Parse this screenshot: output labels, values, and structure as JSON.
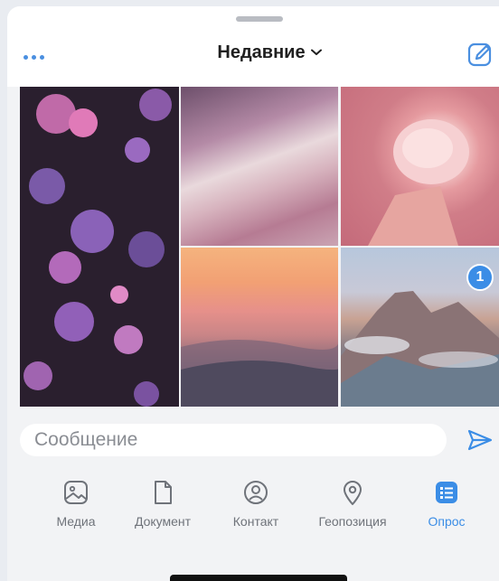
{
  "header": {
    "title": "Недавние",
    "more_icon": "more-dots-icon",
    "dropdown_icon": "chevron-down-icon",
    "edit_icon": "edit-icon"
  },
  "gallery": {
    "tiles": [
      {
        "name": "photo-purple-flowers"
      },
      {
        "name": "photo-watercolor"
      },
      {
        "name": "photo-pink-flower"
      },
      {
        "name": "photo-sunset-hills"
      },
      {
        "name": "photo-mountain",
        "selected_index": "1"
      }
    ]
  },
  "composer": {
    "placeholder": "Сообщение",
    "value": "",
    "send_icon": "send-icon"
  },
  "actions": [
    {
      "label": "Медиа",
      "icon": "image-icon",
      "active": false
    },
    {
      "label": "Документ",
      "icon": "document-icon",
      "active": false
    },
    {
      "label": "Контакт",
      "icon": "contact-icon",
      "active": false
    },
    {
      "label": "Геопозиция",
      "icon": "location-pin-icon",
      "active": false
    },
    {
      "label": "Опрос",
      "icon": "poll-icon",
      "active": true
    }
  ],
  "colors": {
    "accent": "#3b8de6",
    "label": "#6f737a",
    "background": "#f2f3f5"
  }
}
